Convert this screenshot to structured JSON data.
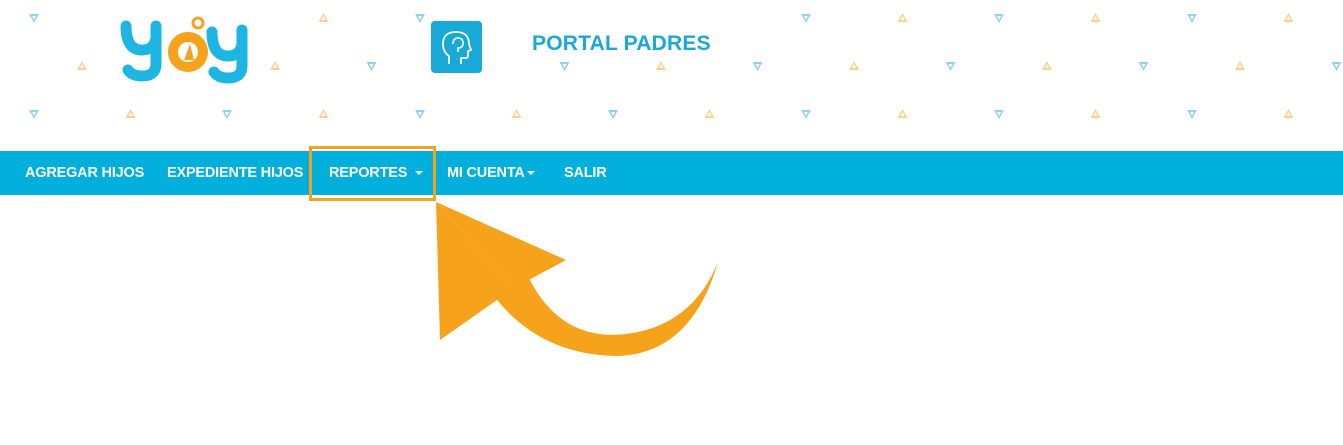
{
  "header": {
    "logo_text": "yoy",
    "portal_title": "PORTAL PADRES",
    "portal_icon": "person-head-icon"
  },
  "nav": {
    "items": [
      {
        "label": "AGREGAR HIJOS",
        "has_dropdown": false
      },
      {
        "label": "EXPEDIENTE HIJOS",
        "has_dropdown": false
      },
      {
        "label": "REPORTES",
        "has_dropdown": true,
        "highlighted": true
      },
      {
        "label": "MI CUENTA",
        "has_dropdown": true
      },
      {
        "label": "SALIR",
        "has_dropdown": false
      }
    ]
  },
  "annotation": {
    "type": "curved-arrow",
    "points_to": "REPORTES"
  },
  "colors": {
    "navbar": "#00afdc",
    "title": "#1aa8d8",
    "highlight": "#f7a21b",
    "pattern_blue": "#8ed4ee",
    "pattern_orange": "#f9d28e"
  }
}
